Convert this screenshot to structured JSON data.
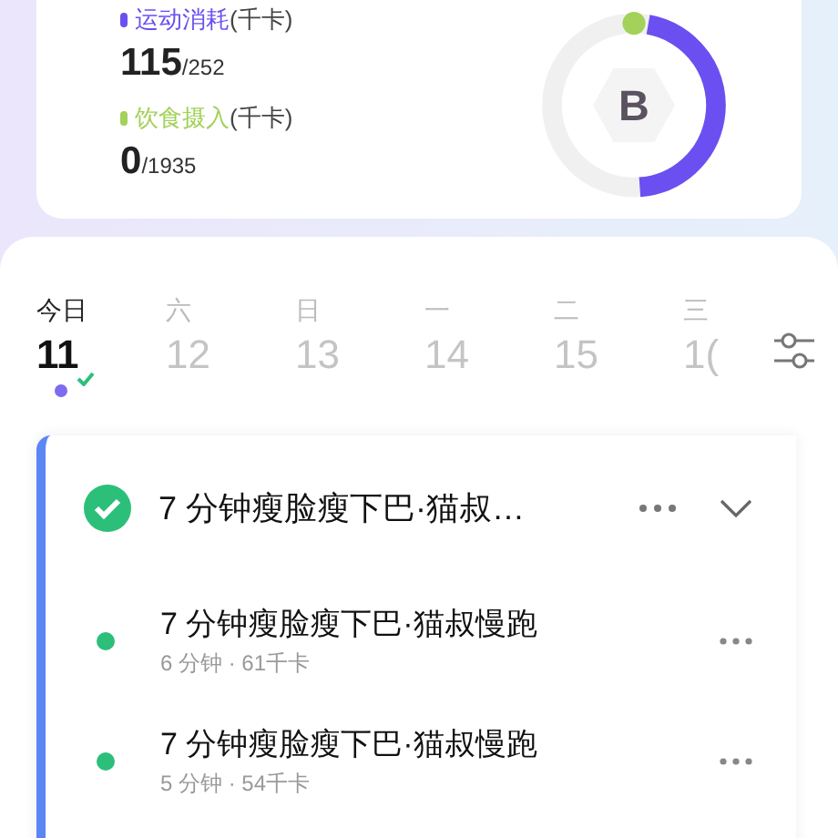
{
  "summary": {
    "stats": [
      {
        "label": "运动消耗",
        "unit": "(千卡)",
        "value": "115",
        "total": "/252",
        "color": "#6c4ff0"
      },
      {
        "label": "饮食摄入",
        "unit": "(千卡)",
        "value": "0",
        "total": "/1935",
        "color": "#a3d15a"
      }
    ],
    "ring": {
      "grade": "B",
      "level": 0.46
    }
  },
  "days": [
    {
      "weekday": "今日",
      "date": "11",
      "selected": true,
      "done": true
    },
    {
      "weekday": "六",
      "date": "12",
      "selected": false,
      "done": false
    },
    {
      "weekday": "日",
      "date": "13",
      "selected": false,
      "done": false
    },
    {
      "weekday": "一",
      "date": "14",
      "selected": false,
      "done": false
    },
    {
      "weekday": "二",
      "date": "15",
      "selected": false,
      "done": false
    },
    {
      "weekday": "三",
      "date": "1(",
      "selected": false,
      "done": false
    }
  ],
  "plan": {
    "title": "7 分钟瘦脸瘦下巴·猫叔…",
    "done": true,
    "expanded": true,
    "items": [
      {
        "title": "7 分钟瘦脸瘦下巴·猫叔慢跑",
        "meta": "6 分钟 · 61千卡"
      },
      {
        "title": "7 分钟瘦脸瘦下巴·猫叔慢跑",
        "meta": "5 分钟 · 54千卡"
      }
    ]
  }
}
